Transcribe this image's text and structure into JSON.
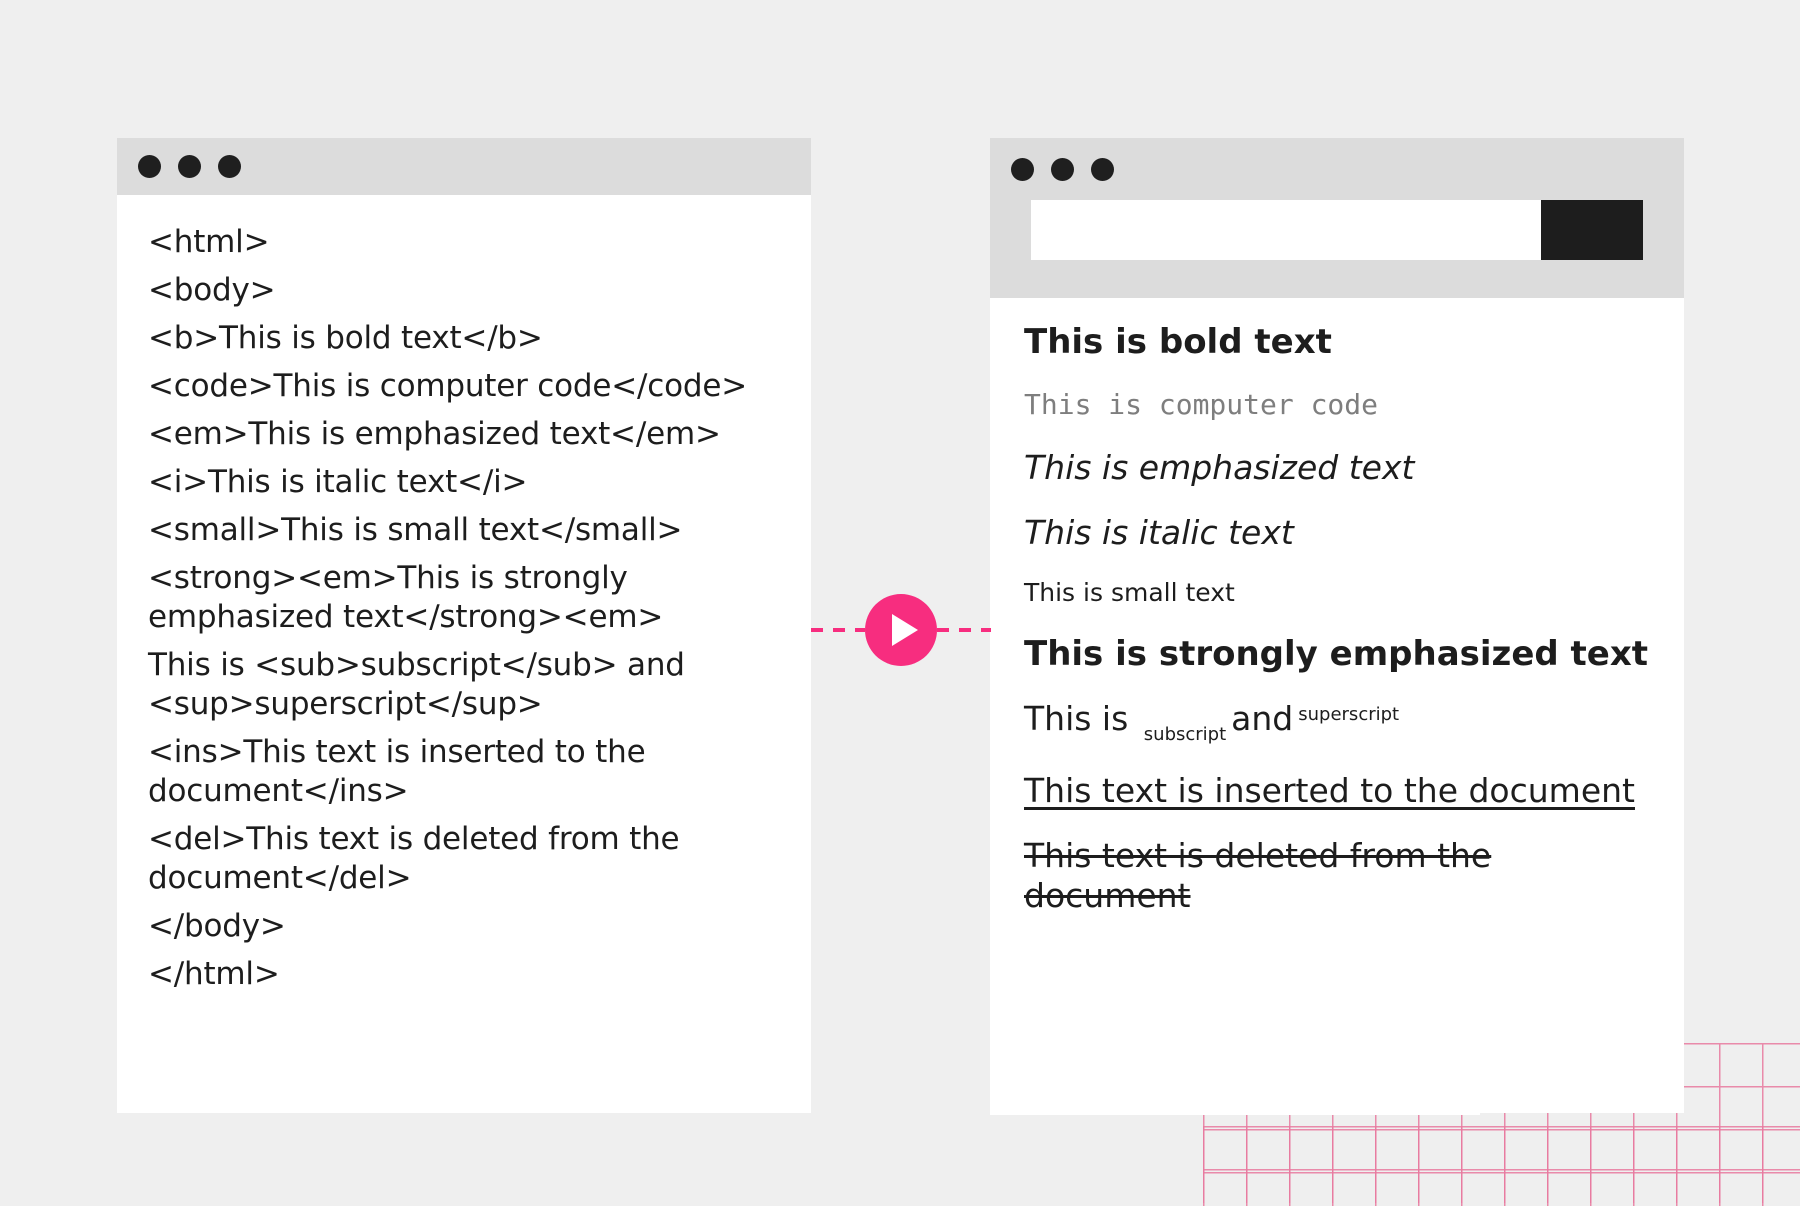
{
  "colors": {
    "page_background": "#efefef",
    "titlebar": "#dcdcdc",
    "window_background": "#ffffff",
    "dot": "#1f1f1f",
    "accent_pink": "#f72d7f",
    "grid_pink": "#e8799f",
    "go_button": "#1d1d1d",
    "code_gray": "#7e7e7e",
    "text": "#1d1d1d"
  },
  "code_window": {
    "traffic_lights": [
      "window-dot-1",
      "window-dot-2",
      "window-dot-3"
    ],
    "lines": [
      "<html>",
      "<body>",
      "<b>This is bold text</b>",
      "<code>This is computer code</code>",
      "<em>This is emphasized text</em>",
      "<i>This is italic text</i>",
      "<small>This is small text</small>",
      "<strong><em>This is strongly emphasized text</strong><em>",
      "This is <sub>subscript</sub> and <sup>superscript</sup>",
      "<ins>This text is inserted to the document</ins>",
      "<del>This text is deleted from the document</del>",
      "</body>",
      "</html>"
    ]
  },
  "connector": {
    "play_icon": "play-triangle-icon",
    "label": "run"
  },
  "preview_window": {
    "traffic_lights": [
      "window-dot-1",
      "window-dot-2",
      "window-dot-3"
    ],
    "address_bar": {
      "value": "",
      "placeholder": "",
      "go_label": ""
    },
    "content": {
      "bold": "This is bold text",
      "code": "This is computer code",
      "emphasized": "This is emphasized text",
      "italic": "This is italic text",
      "small": "This is small text",
      "strong_emphasized": "This is strongly emphasized text",
      "subsup_prefix": "This is ",
      "subscript": "subscript",
      "subsup_middle": "and",
      "superscript": "superscript",
      "inserted": "This text is inserted to the document",
      "deleted": "This text is deleted from the document"
    }
  }
}
